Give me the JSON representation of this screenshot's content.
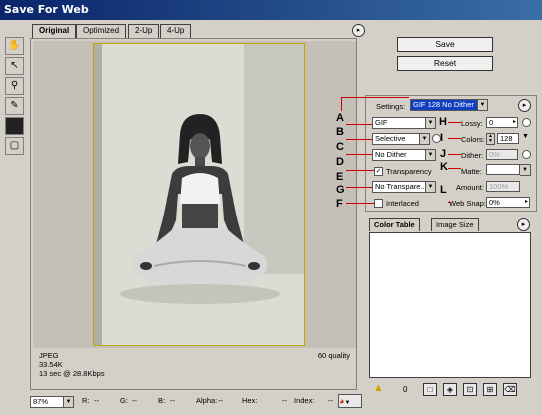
{
  "window": {
    "title": "Save For Web"
  },
  "tabs": [
    {
      "label": "Original"
    },
    {
      "label": "Optimized"
    },
    {
      "label": "2-Up"
    },
    {
      "label": "4-Up"
    }
  ],
  "canvas": {
    "format": "JPEG",
    "size": "33.54K",
    "time": "13 sec @ 28.8Kbps",
    "quality": "60 quality"
  },
  "buttons": {
    "save": "Save",
    "reset": "Reset"
  },
  "settings": {
    "label": "Settings:",
    "preset": "GIF 128 No Dither",
    "format": "GIF",
    "palette": "Selective",
    "dither": "No Dither",
    "transparency": "Transparency",
    "transparency_dither": "No Transpare...",
    "interlaced": "Interlaced",
    "lossy_label": "Lossy:",
    "lossy_value": "0",
    "colors_label": "Colors:",
    "colors_value": "128",
    "dither_label": "Dither:",
    "dither_value": "0%",
    "matte_label": "Matte:",
    "amount_label": "Amount:",
    "amount_value": "100%",
    "websnap_label": "Web Snap:",
    "websnap_value": "0%"
  },
  "callouts": [
    "A",
    "B",
    "C",
    "D",
    "E",
    "F",
    "G",
    "H",
    "I",
    "J",
    "K",
    "L"
  ],
  "color_table": {
    "tabs": [
      {
        "label": "Color Table"
      },
      {
        "label": "Image Size"
      }
    ],
    "count": "0"
  },
  "statusbar": {
    "zoom": "87%",
    "r": "R:",
    "r_val": "--",
    "g": "G:",
    "g_val": "--",
    "b": "B:",
    "b_val": "--",
    "alpha": "Alpha:",
    "alpha_val": "--",
    "hex": "Hex:",
    "hex_val": "--",
    "index": "Index:",
    "index_val": "--"
  },
  "colors": {
    "callout_line": "#d00000",
    "titlebar": "#0a246a",
    "photo_border": "#c8a000"
  }
}
